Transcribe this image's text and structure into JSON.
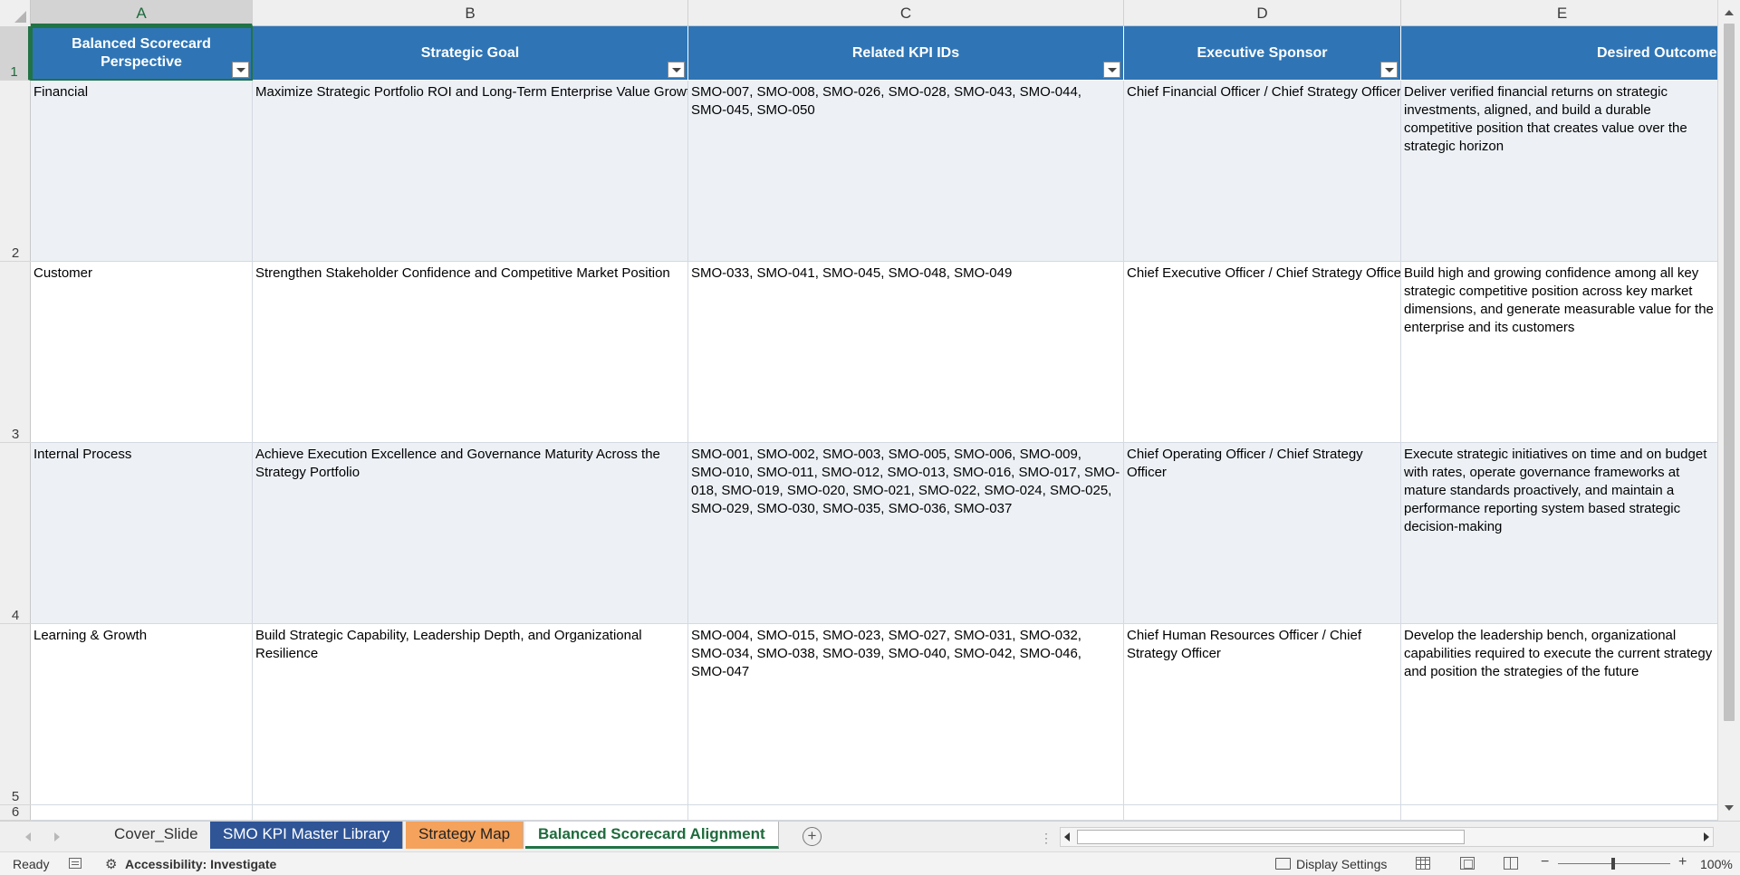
{
  "columns": [
    "A",
    "B",
    "C",
    "D",
    "E"
  ],
  "rows": [
    "1",
    "2",
    "3",
    "4",
    "5",
    "6"
  ],
  "header": {
    "perspective": "Balanced Scorecard Perspective",
    "goal": "Strategic Goal",
    "kpis": "Related KPI IDs",
    "sponsor": "Executive Sponsor",
    "outcome": "Desired Outcome"
  },
  "data_rows": [
    {
      "perspective": "Financial",
      "goal": "Maximize Strategic Portfolio ROI and Long-Term Enterprise Value Growth",
      "kpis": "SMO-007, SMO-008, SMO-026, SMO-028, SMO-043, SMO-044, SMO-045, SMO-050",
      "sponsor": "Chief Financial Officer / Chief Strategy Officer",
      "outcome": "Deliver verified financial returns on strategic investments, aligned, and build a durable competitive position that creates value over the strategic horizon"
    },
    {
      "perspective": "Customer",
      "goal": "Strengthen Stakeholder Confidence and Competitive Market Position",
      "kpis": "SMO-033, SMO-041, SMO-045, SMO-048, SMO-049",
      "sponsor": "Chief Executive Officer / Chief Strategy Officer",
      "outcome": "Build high and growing confidence among all key strategic competitive position across key market dimensions, and generate measurable value for the enterprise and its customers"
    },
    {
      "perspective": "Internal Process",
      "goal": "Achieve Execution Excellence and Governance Maturity Across the Strategy Portfolio",
      "kpis": "SMO-001, SMO-002, SMO-003, SMO-005, SMO-006, SMO-009, SMO-010, SMO-011, SMO-012, SMO-013, SMO-016, SMO-017, SMO-018, SMO-019, SMO-020, SMO-021, SMO-022, SMO-024, SMO-025, SMO-029, SMO-030, SMO-035, SMO-036, SMO-037",
      "sponsor": "Chief Operating Officer / Chief Strategy Officer",
      "outcome": "Execute strategic initiatives on time and on budget with rates, operate governance frameworks at mature standards proactively, and maintain a performance reporting system based strategic decision-making"
    },
    {
      "perspective": "Learning & Growth",
      "goal": "Build Strategic Capability, Leadership Depth, and Organizational Resilience",
      "kpis": "SMO-004, SMO-015, SMO-023, SMO-027, SMO-031, SMO-032, SMO-034, SMO-038, SMO-039, SMO-040, SMO-042, SMO-046, SMO-047",
      "sponsor": "Chief Human Resources Officer / Chief Strategy Officer",
      "outcome": "Develop the leadership bench, organizational capabilities required to execute the current strategy and position the strategies of the future"
    }
  ],
  "tabs": {
    "cover": "Cover_Slide",
    "kpi_library": "SMO KPI Master Library",
    "strategy_map": "Strategy Map",
    "alignment": "Balanced Scorecard Alignment"
  },
  "tab_colors": {
    "kpi_library": "#2f5597",
    "strategy_map": "#f4a25c",
    "header_fill": "#2f75b5"
  },
  "status": {
    "ready": "Ready",
    "accessibility": "Accessibility: Investigate",
    "display_settings": "Display Settings",
    "zoom": "100%"
  },
  "icons": [
    "macro-record-icon",
    "accessibility-icon",
    "display-settings-icon",
    "normal-view-icon",
    "page-layout-icon",
    "page-break-icon",
    "add-sheet-icon"
  ]
}
